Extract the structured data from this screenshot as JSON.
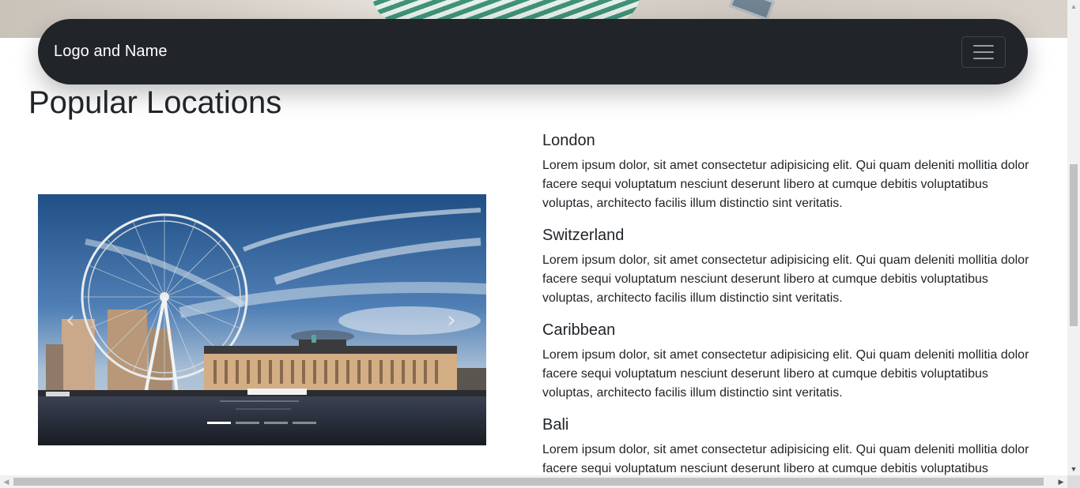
{
  "navbar": {
    "brand": "Logo and Name",
    "toggler_icon": "hamburger-menu-icon"
  },
  "section": {
    "title": "Popular Locations"
  },
  "carousel": {
    "image_subject": "London Eye and County Hall by the Thames",
    "prev_icon": "chevron-left-icon",
    "next_icon": "chevron-right-icon",
    "prev_glyph": "‹",
    "next_glyph": "›",
    "slide_count": 4,
    "active_slide": 1
  },
  "locations": [
    {
      "name": "London",
      "text": "Lorem ipsum dolor, sit amet consectetur adipisicing elit. Qui quam deleniti mollitia dolor facere sequi voluptatum nesciunt deserunt libero at cumque debitis voluptatibus voluptas, architecto facilis illum distinctio sint veritatis."
    },
    {
      "name": "Switzerland",
      "text": "Lorem ipsum dolor, sit amet consectetur adipisicing elit. Qui quam deleniti mollitia dolor facere sequi voluptatum nesciunt deserunt libero at cumque debitis voluptatibus voluptas, architecto facilis illum distinctio sint veritatis."
    },
    {
      "name": "Caribbean",
      "text": "Lorem ipsum dolor, sit amet consectetur adipisicing elit. Qui quam deleniti mollitia dolor facere sequi voluptatum nesciunt deserunt libero at cumque debitis voluptatibus voluptas, architecto facilis illum distinctio sint veritatis."
    },
    {
      "name": "Bali",
      "text": "Lorem ipsum dolor, sit amet consectetur adipisicing elit. Qui quam deleniti mollitia dolor facere sequi voluptatum nesciunt deserunt libero at cumque debitis voluptatibus"
    }
  ],
  "colors": {
    "navbar_bg": "#212529",
    "text": "#212529",
    "page_bg": "#ffffff"
  }
}
